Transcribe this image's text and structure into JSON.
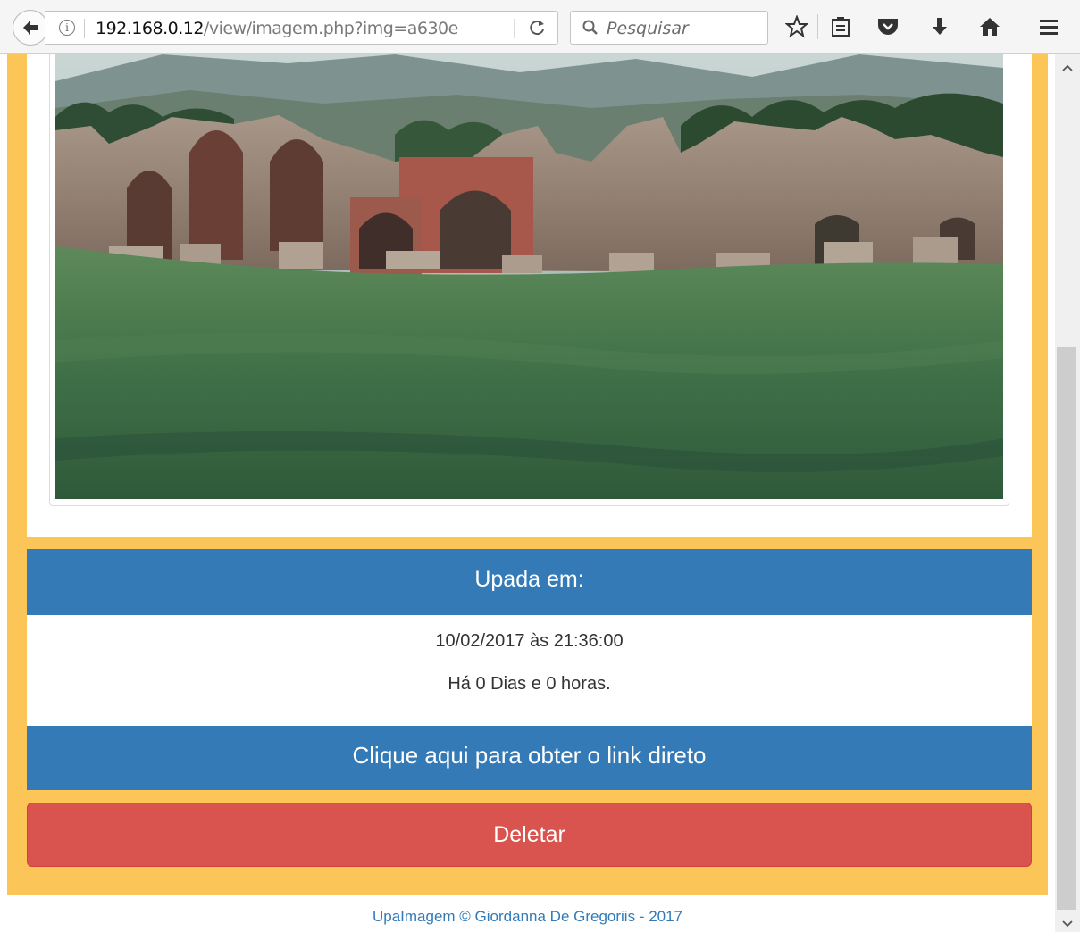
{
  "browser": {
    "url_host": "192.168.0.12",
    "url_path": "/view/imagem.php?img=a630e",
    "search_placeholder": "Pesquisar"
  },
  "upload_panel": {
    "heading": "Upada em:",
    "datetime": "10/02/2017 às 21:36:00",
    "age": "Há 0 Dias e 0 horas."
  },
  "direct_link_label": "Clique aqui para obter o link direto",
  "delete_label": "Deletar",
  "footer_text": "UpaImagem © Giordanna De Gregoriis - 2017",
  "colors": {
    "page_frame": "#fbc657",
    "primary": "#337ab7",
    "danger": "#d9534f"
  }
}
